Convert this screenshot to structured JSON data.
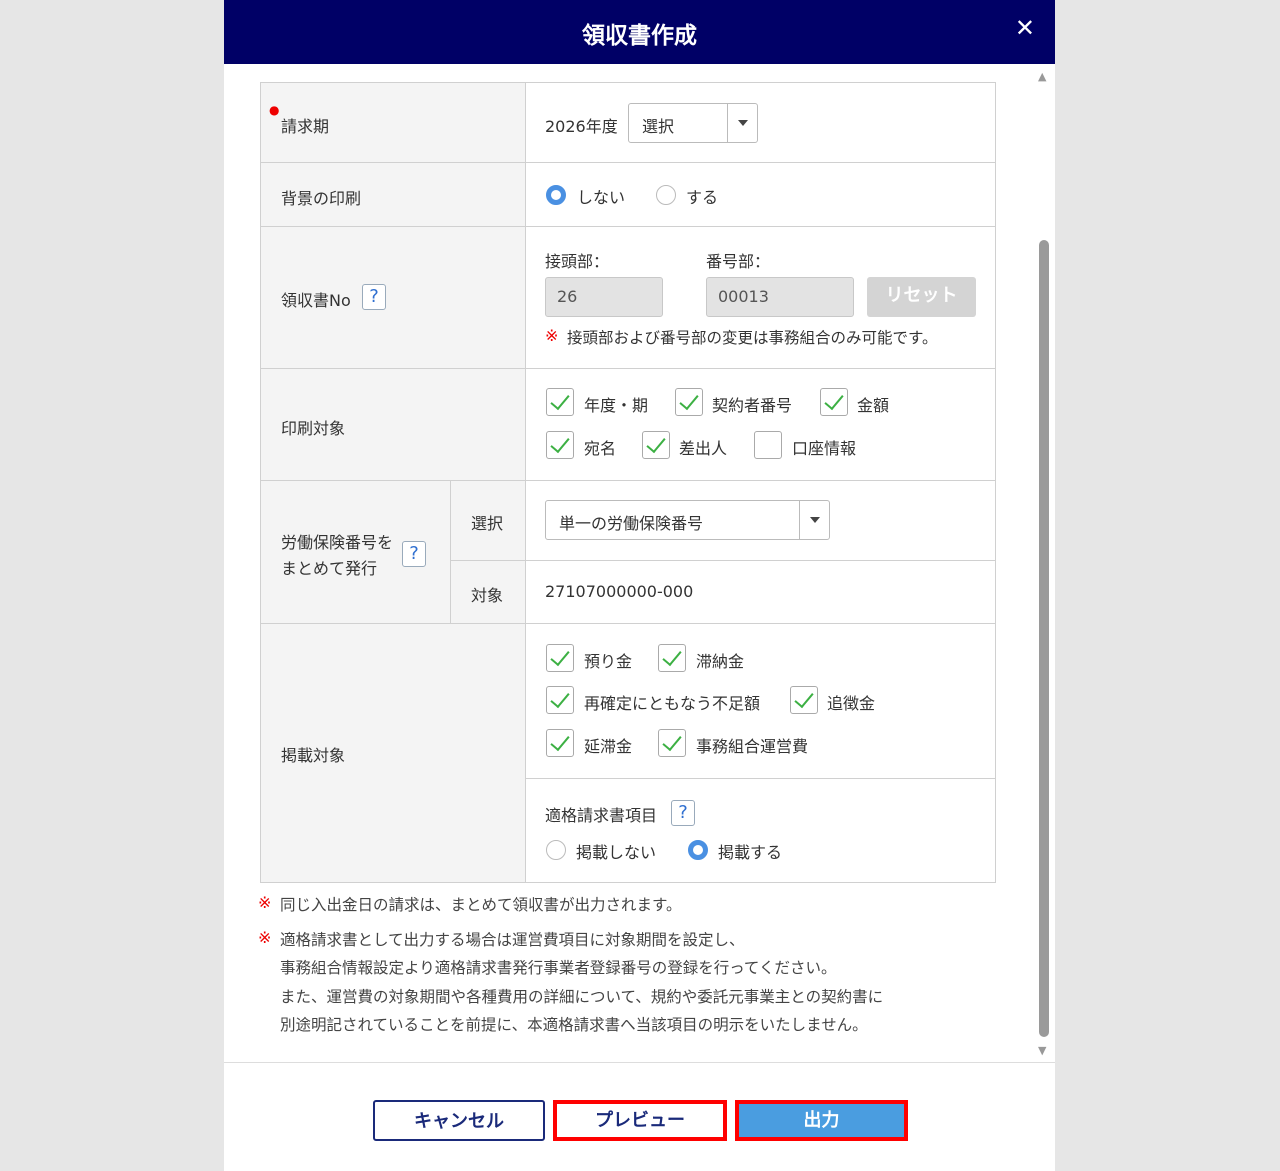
{
  "dialog": {
    "title": "領収書作成",
    "close_icon": "close-icon"
  },
  "rows": {
    "billing_period": {
      "label": "請求期",
      "year": "2026年度",
      "select_value": "選択"
    },
    "background_print": {
      "label": "背景の印刷",
      "options": [
        "しない",
        "する"
      ],
      "selected": "しない"
    },
    "receipt_no": {
      "label": "領収書No",
      "help": "?",
      "prefix_label": "接頭部：",
      "number_label": "番号部：",
      "prefix_value": "26",
      "number_value": "00013",
      "reset_label": "リセット",
      "note_mark": "※",
      "note": "接頭部および番号部の変更は事務組合のみ可能です。"
    },
    "print_target": {
      "label": "印刷対象",
      "items": [
        {
          "label": "年度・期",
          "checked": true
        },
        {
          "label": "契約者番号",
          "checked": true
        },
        {
          "label": "金額",
          "checked": true
        },
        {
          "label": "宛名",
          "checked": true
        },
        {
          "label": "差出人",
          "checked": true
        },
        {
          "label": "口座情報",
          "checked": false
        }
      ]
    },
    "labor_insurance": {
      "label_line1": "労働保険番号を",
      "label_line2": "まとめて発行",
      "help": "?",
      "select_label": "選択",
      "select_value": "単一の労働保険番号",
      "target_label": "対象",
      "target_value": "27107000000-000"
    },
    "listing_target": {
      "label": "掲載対象",
      "items": [
        {
          "label": "預り金",
          "checked": true
        },
        {
          "label": "滞納金",
          "checked": true
        },
        {
          "label": "再確定にともなう不足額",
          "checked": true
        },
        {
          "label": "追徴金",
          "checked": true
        },
        {
          "label": "延滞金",
          "checked": true
        },
        {
          "label": "事務組合運営費",
          "checked": true
        }
      ],
      "invoice_label": "適格請求書項目",
      "help": "?",
      "invoice_options": [
        "掲載しない",
        "掲載する"
      ],
      "invoice_selected": "掲載する"
    }
  },
  "notes": {
    "mark": "※",
    "note1": "同じ入出金日の請求は、まとめて領収書が出力されます。",
    "note2_lines": [
      "適格請求書として出力する場合は運営費項目に対象期間を設定し、",
      "事務組合情報設定より適格請求書発行事業者登録番号の登録を行ってください。",
      "また、運営費の対象期間や各種費用の詳細について、規約や委託元事業主との契約書に",
      "別途明記されていることを前提に、本適格請求書へ当該項目の明示をいたしません。"
    ]
  },
  "footer": {
    "cancel": "キャンセル",
    "preview": "プレビュー",
    "output": "出力"
  },
  "colors": {
    "header": "#000066",
    "primary": "#4a9de0",
    "highlight": "#ff0000"
  }
}
